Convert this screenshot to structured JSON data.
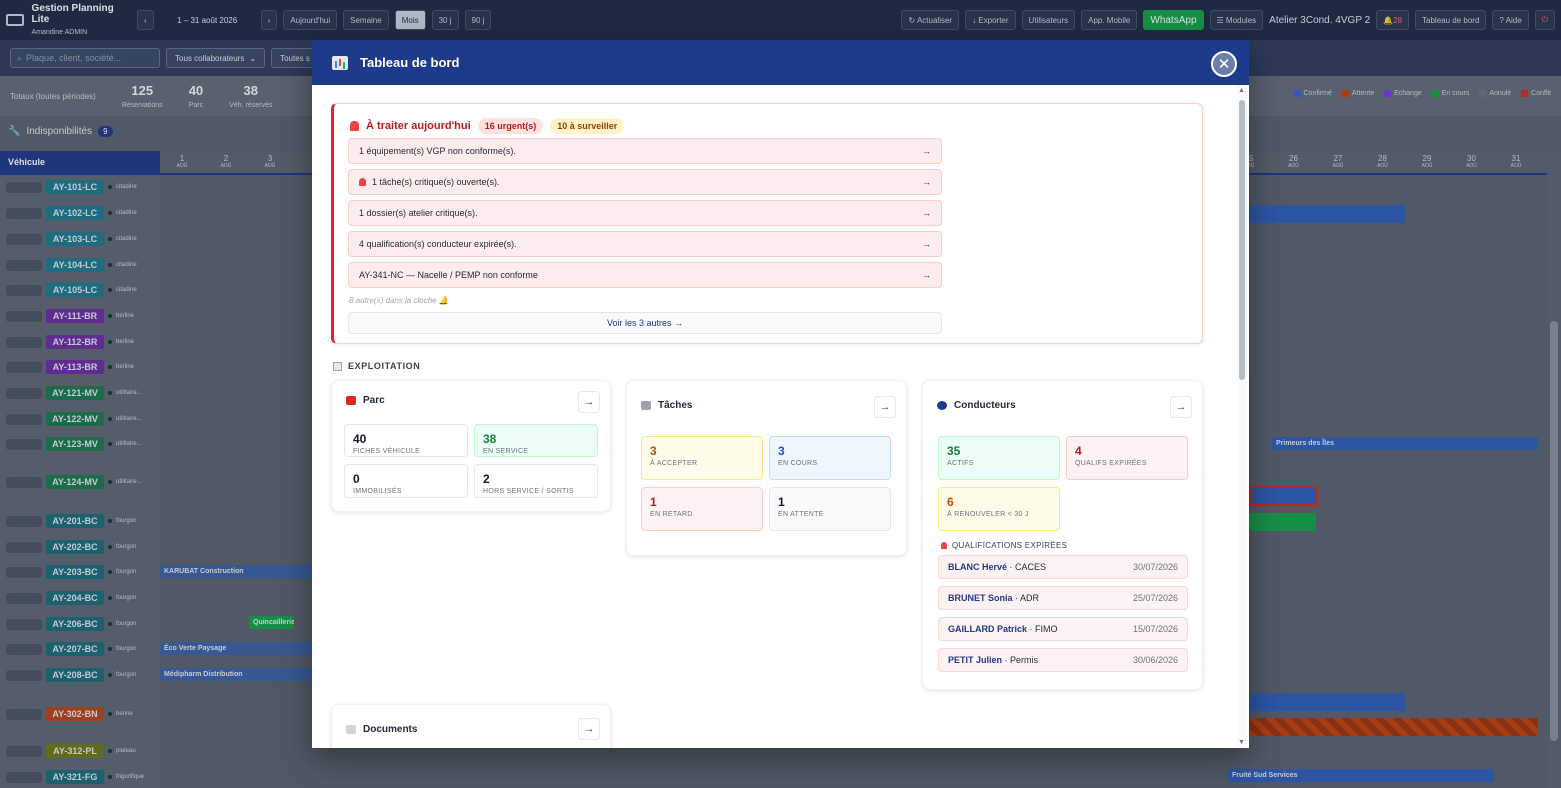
{
  "app": {
    "title": "Gestion Planning Lite",
    "user": "Amandine ADMIN"
  },
  "toolbar": {
    "period": "1 – 31 août 2026",
    "prev": "‹",
    "next": "›",
    "views": [
      "Aujourd'hui",
      "Semaine",
      "Mois",
      "30 j",
      "90 j"
    ],
    "active_view": "Mois",
    "refresh": "↻ Actualiser",
    "export": "↓ Exporter",
    "users": "Utilisateurs",
    "app_mobile": "App. Mobile",
    "whatsapp": "WhatsApp",
    "modules": "☰ Modules",
    "atelier": "Atelier 3Cond. 4VGP 2",
    "bell_count": "28",
    "dashboard": "Tableau de bord",
    "help": "? Aide"
  },
  "filters": {
    "search_placeholder": "Plaque, client, société...",
    "collab": "Tous collaborateurs",
    "other": "Toutes s"
  },
  "stats": {
    "label": "Totaux (toutes périodes)",
    "items": [
      {
        "value": "125",
        "label": "Réservations"
      },
      {
        "value": "40",
        "label": "Parc"
      },
      {
        "value": "38",
        "label": "Véh. réservés"
      }
    ]
  },
  "legend": [
    "Confirmé",
    "Attente",
    "Echange",
    "En cours",
    "Annulé",
    "Conflit"
  ],
  "legend_colors": [
    "#3b63c4",
    "#c2410c",
    "#7c3aed",
    "#16a34a",
    "#6b7280",
    "#dc2626"
  ],
  "indispo": {
    "label": "Indisponibilités",
    "count": "9"
  },
  "grid": {
    "vehicle_header": "Véhicule",
    "days_left": [
      "1",
      "2",
      "3"
    ],
    "days_right": [
      "25",
      "26",
      "27",
      "28",
      "29",
      "30",
      "31"
    ],
    "day_sub": "AOÛ"
  },
  "vehicles": [
    {
      "plate": "AY-101-LC",
      "type": "citadine",
      "color": "#1e7a8f"
    },
    {
      "plate": "AY-102-LC",
      "type": "citadine",
      "color": "#1e7a8f"
    },
    {
      "plate": "AY-103-LC",
      "type": "citadine",
      "color": "#1e7a8f"
    },
    {
      "plate": "AY-104-LC",
      "type": "citadine",
      "color": "#1e7a8f"
    },
    {
      "plate": "AY-105-LC",
      "type": "citadine",
      "color": "#1e7a8f"
    },
    {
      "plate": "AY-111-BR",
      "type": "berline",
      "color": "#6b2fa3"
    },
    {
      "plate": "AY-112-BR",
      "type": "berline",
      "color": "#6b2fa3"
    },
    {
      "plate": "AY-113-BR",
      "type": "berline",
      "color": "#6b2fa3"
    },
    {
      "plate": "AY-121-MV",
      "type": "utilitaire...",
      "color": "#1c7a4f"
    },
    {
      "plate": "AY-122-MV",
      "type": "utilitaire...",
      "color": "#1c7a4f"
    },
    {
      "plate": "AY-123-MV",
      "type": "utilitaire...",
      "color": "#1c7a4f"
    },
    {
      "plate": "AY-124-MV",
      "type": "utilitaire...",
      "color": "#1c7a4f"
    },
    {
      "plate": "AY-201-BC",
      "type": "fourgon",
      "color": "#1c6d7a"
    },
    {
      "plate": "AY-202-BC",
      "type": "fourgon",
      "color": "#1c6d7a"
    },
    {
      "plate": "AY-203-BC",
      "type": "fourgon",
      "color": "#1c6d7a"
    },
    {
      "plate": "AY-204-BC",
      "type": "fourgon",
      "color": "#1c6d7a"
    },
    {
      "plate": "AY-206-BC",
      "type": "fourgon",
      "color": "#1c6d7a"
    },
    {
      "plate": "AY-207-BC",
      "type": "fourgon",
      "color": "#1c6d7a"
    },
    {
      "plate": "AY-208-BC",
      "type": "fourgon",
      "color": "#1c6d7a"
    },
    {
      "plate": "AY-302-BN",
      "type": "benne",
      "color": "#b4461c"
    },
    {
      "plate": "AY-312-PL",
      "type": "plateau",
      "color": "#6b7a1c"
    },
    {
      "plate": "AY-321-FG",
      "type": "frigorifique",
      "color": "#1c6d7a"
    }
  ],
  "bookings": [
    "KARUBAT Construction",
    "Quincaillerie",
    "Éco Verte Paysage",
    "Médipharm Distribution",
    "Primeurs des Îles",
    "Fruité Sud Services"
  ],
  "modal": {
    "title": "Tableau de bord",
    "close": "✕",
    "today": {
      "title": "À traiter aujourd'hui",
      "urgent": "16 urgent(s)",
      "watch": "10 à surveiller",
      "items": [
        {
          "text": "1 équipement(s) VGP non conforme(s).",
          "icon": "none"
        },
        {
          "text": "1 tâche(s) critique(s) ouverte(s).",
          "icon": "bell-icon"
        },
        {
          "text": "1 dossier(s) atelier critique(s).",
          "icon": "none"
        },
        {
          "text": "4 qualification(s) conducteur expirée(s).",
          "icon": "none"
        },
        {
          "text": "AY-341-NC — Nacelle / PEMP non conforme",
          "icon": "none"
        }
      ],
      "arrow": "→",
      "more": "8 autre(s) dans la cloche 🔔",
      "see_all": "Voir les 3 autres →"
    },
    "section": "EXPLOITATION",
    "parc": {
      "title": "Parc",
      "arrow": "→",
      "tiles": [
        {
          "value": "40",
          "label": "FICHES VÉHICULE"
        },
        {
          "value": "38",
          "label": "EN SERVICE"
        },
        {
          "value": "0",
          "label": "IMMOBILISÉS"
        },
        {
          "value": "2",
          "label": "HORS SERVICE / SORTIS"
        }
      ]
    },
    "taches": {
      "title": "Tâches",
      "arrow": "→",
      "tiles": [
        {
          "value": "3",
          "label": "À ACCEPTER"
        },
        {
          "value": "3",
          "label": "EN COURS"
        },
        {
          "value": "1",
          "label": "EN RETARD"
        },
        {
          "value": "1",
          "label": "EN ATTENTE"
        }
      ]
    },
    "conducteurs": {
      "title": "Conducteurs",
      "arrow": "→",
      "tiles": [
        {
          "value": "35",
          "label": "ACTIFS"
        },
        {
          "value": "4",
          "label": "QUALIFS EXPIRÉES"
        },
        {
          "value": "6",
          "label": "À RENOUVELER < 30 J"
        }
      ],
      "qual_title": "QUALIFICATIONS EXPIRÉES",
      "quals": [
        {
          "name": "BLANC Hervé",
          "type": "CACES",
          "date": "30/07/2026"
        },
        {
          "name": "BRUNET Sonia",
          "type": "ADR",
          "date": "25/07/2026"
        },
        {
          "name": "GAILLARD Patrick",
          "type": "FIMO",
          "date": "15/07/2026"
        },
        {
          "name": "PETIT Julien",
          "type": "Permis",
          "date": "30/06/2026"
        }
      ]
    },
    "documents": {
      "title": "Documents",
      "arrow": "→"
    }
  }
}
